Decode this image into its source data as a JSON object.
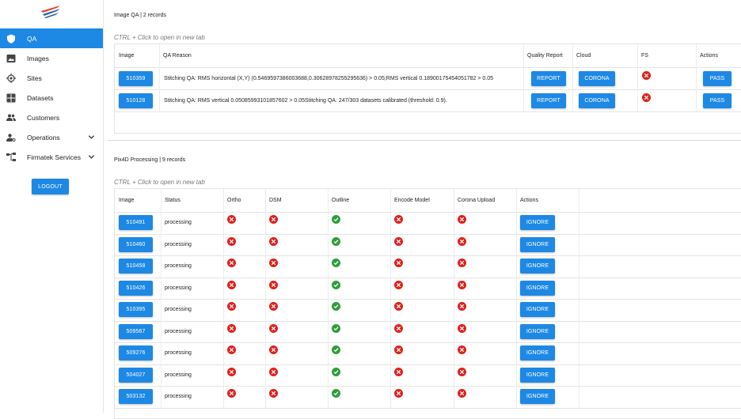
{
  "sidebar": {
    "items": [
      {
        "label": "QA",
        "icon": "shield-icon",
        "active": true
      },
      {
        "label": "Images",
        "icon": "image-icon"
      },
      {
        "label": "Sites",
        "icon": "target-icon"
      },
      {
        "label": "Datasets",
        "icon": "grid-icon"
      },
      {
        "label": "Customers",
        "icon": "people-icon"
      },
      {
        "label": "Operations",
        "icon": "person-gear-icon",
        "expandable": true
      },
      {
        "label": "Firmatek Services",
        "icon": "hierarchy-icon",
        "expandable": true
      }
    ],
    "logout_label": "LOGOUT"
  },
  "image_qa": {
    "title": "Image QA | 2 records",
    "hint": "CTRL + Click to open in new tab",
    "headers": [
      "Image",
      "QA Reason",
      "Quality Report",
      "Cloud",
      "FS",
      "Actions"
    ],
    "rows": [
      {
        "image": "510359",
        "reason": "Stitching QA: RMS horizontal (X,Y) (0.5469597386003688,0.30628978255295636) > 0.05;RMS vertical 0.18900175454051782 > 0.05",
        "report": "REPORT",
        "cloud": "CORONA",
        "fs": "error",
        "action": "PASS"
      },
      {
        "image": "510128",
        "reason": "Stitching QA: RMS vertical 0.05085993101857602 > 0.05Stitching QA: 247/303 datasets calibrated (threshold: 0.9).",
        "report": "REPORT",
        "cloud": "CORONA",
        "fs": "error",
        "action": "PASS"
      }
    ]
  },
  "pix4d": {
    "title": "Pix4D Processing | 9 records",
    "hint": "CTRL + Click to open in new tab",
    "headers": [
      "Image",
      "Status",
      "Ortho",
      "DSM",
      "Outline",
      "Encode Model",
      "Corona Upload",
      "Actions"
    ],
    "rows": [
      {
        "image": "510491",
        "status": "processing",
        "ortho": "error",
        "dsm": "error",
        "outline": "ok",
        "encode": "error",
        "corona": "error",
        "action": "IGNORE"
      },
      {
        "image": "510460",
        "status": "processing",
        "ortho": "error",
        "dsm": "error",
        "outline": "ok",
        "encode": "error",
        "corona": "error",
        "action": "IGNORE"
      },
      {
        "image": "510458",
        "status": "processing",
        "ortho": "error",
        "dsm": "error",
        "outline": "ok",
        "encode": "error",
        "corona": "error",
        "action": "IGNORE"
      },
      {
        "image": "510426",
        "status": "processing",
        "ortho": "error",
        "dsm": "error",
        "outline": "ok",
        "encode": "error",
        "corona": "error",
        "action": "IGNORE"
      },
      {
        "image": "510395",
        "status": "processing",
        "ortho": "error",
        "dsm": "error",
        "outline": "ok",
        "encode": "error",
        "corona": "error",
        "action": "IGNORE"
      },
      {
        "image": "509567",
        "status": "processing",
        "ortho": "error",
        "dsm": "error",
        "outline": "ok",
        "encode": "error",
        "corona": "error",
        "action": "IGNORE"
      },
      {
        "image": "509276",
        "status": "processing",
        "ortho": "error",
        "dsm": "error",
        "outline": "ok",
        "encode": "error",
        "corona": "error",
        "action": "IGNORE"
      },
      {
        "image": "504027",
        "status": "processing",
        "ortho": "error",
        "dsm": "error",
        "outline": "ok",
        "encode": "error",
        "corona": "error",
        "action": "IGNORE"
      },
      {
        "image": "503132",
        "status": "processing",
        "ortho": "error",
        "dsm": "error",
        "outline": "ok",
        "encode": "error",
        "corona": "error",
        "action": "IGNORE"
      }
    ]
  },
  "colors": {
    "primary": "#1e88e5",
    "error": "#e0201b",
    "ok": "#2e9e3a"
  }
}
